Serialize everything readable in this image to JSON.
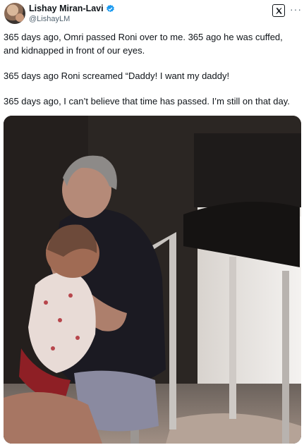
{
  "author": {
    "display_name": "Lishay Miran-Lavi",
    "handle": "@LishayLM",
    "verified": true
  },
  "icons": {
    "verified": "verified-badge-icon",
    "x_logo": "x-logo-icon",
    "more": "more-options-icon"
  },
  "colors": {
    "verified_badge": "#1d9bf0",
    "text_primary": "#0f1419",
    "text_secondary": "#536471"
  },
  "tweet": {
    "paragraphs": [
      "365 days ago, Omri passed Roni over to me. 365 ago he was cuffed, and kidnapped in front of our eyes.",
      "365 days ago Roni screamed “Daddy! I want my daddy!",
      "365 days ago, I can’t believe that time has passed. I’m still on that day."
    ]
  },
  "more_label": "···"
}
